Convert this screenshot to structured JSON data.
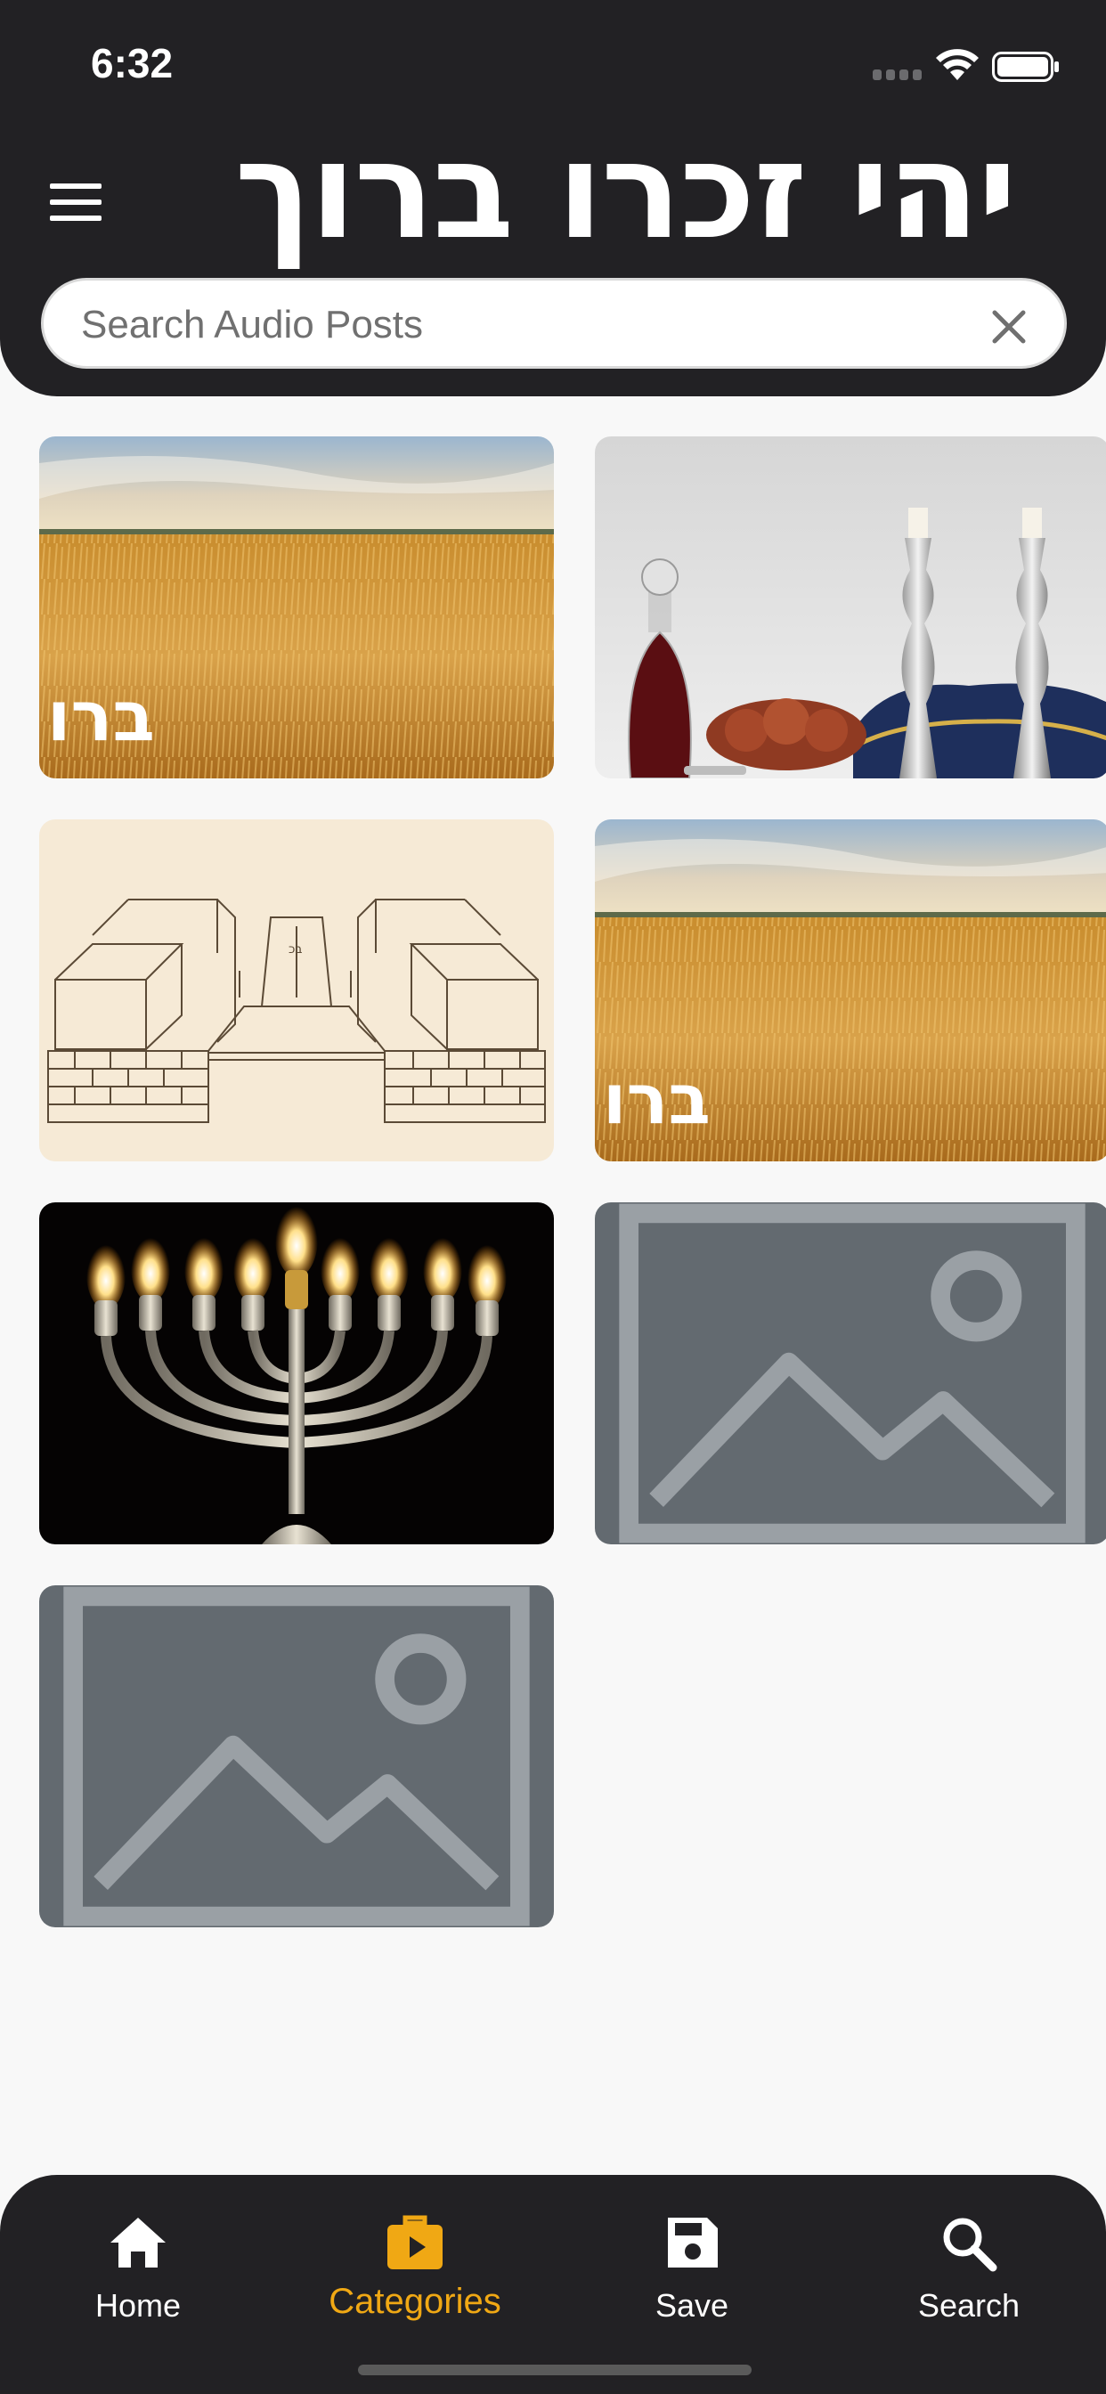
{
  "status_bar": {
    "time": "6:32"
  },
  "header": {
    "title": "יהי זכרו ברוך",
    "menu_icon": "hamburger-menu-icon"
  },
  "search": {
    "placeholder": "Search Audio Posts",
    "value": "",
    "clear_icon": "close-icon"
  },
  "grid": {
    "items": [
      {
        "kind": "wheat-field",
        "overlay_text": "ברו"
      },
      {
        "kind": "shabbat-table",
        "overlay_text": ""
      },
      {
        "kind": "sketch-drawing",
        "overlay_text": ""
      },
      {
        "kind": "wheat-field",
        "overlay_text": "ברו"
      },
      {
        "kind": "menorah",
        "overlay_text": ""
      },
      {
        "kind": "placeholder",
        "icon": "image-placeholder-icon"
      },
      {
        "kind": "placeholder",
        "icon": "image-placeholder-icon"
      }
    ]
  },
  "bottom_nav": {
    "items": [
      {
        "label": "Home",
        "icon": "home-icon",
        "active": false
      },
      {
        "label": "Categories",
        "icon": "categories-icon",
        "active": true
      },
      {
        "label": "Save",
        "icon": "save-icon",
        "active": false
      },
      {
        "label": "Search",
        "icon": "search-icon",
        "active": false
      }
    ]
  },
  "colors": {
    "header_bg": "#222124",
    "accent": "#f0a814",
    "placeholder_bg": "#636a70",
    "page_bg": "#f8f8f8"
  }
}
